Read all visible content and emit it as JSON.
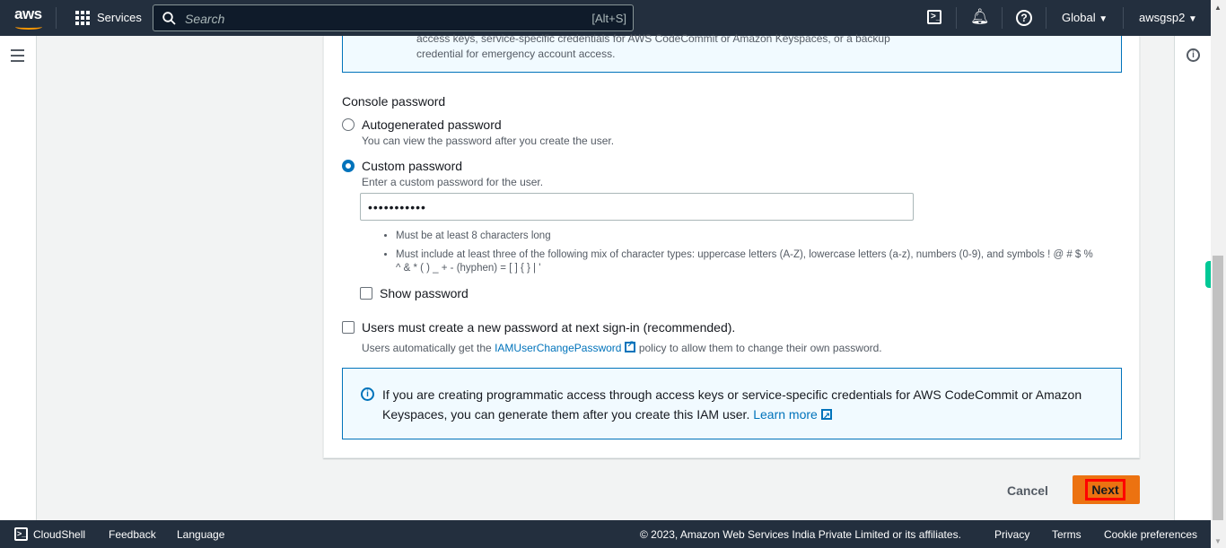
{
  "nav": {
    "logo": "aws",
    "services": "Services",
    "search_placeholder": "Search",
    "search_shortcut": "[Alt+S]",
    "region": "Global",
    "account": "awsgsp2"
  },
  "top_info": {
    "line1": "access keys, service-specific credentials for AWS CodeCommit or Amazon Keyspaces, or a backup",
    "line2": "credential for emergency account access."
  },
  "console_password": {
    "label": "Console password",
    "autogen": {
      "label": "Autogenerated password",
      "desc": "You can view the password after you create the user.",
      "selected": false
    },
    "custom": {
      "label": "Custom password",
      "desc": "Enter a custom password for the user.",
      "selected": true,
      "value": "•••••••••••"
    },
    "rules": [
      "Must be at least 8 characters long",
      "Must include at least three of the following mix of character types: uppercase letters (A-Z), lowercase letters (a-z), numbers (0-9), and symbols ! @ # $ % ^ & * ( ) _ + - (hyphen) = [ ] { } | '"
    ],
    "show_password": "Show password",
    "must_change": "Users must create a new password at next sign-in (recommended).",
    "policy_pre": "Users automatically get the ",
    "policy_link": "IAMUserChangePassword",
    "policy_post": " policy to allow them to change their own password."
  },
  "bottom_info": {
    "text": "If you are creating programmatic access through access keys or service-specific credentials for AWS CodeCommit or Amazon Keyspaces, you can generate them after you create this IAM user.",
    "link": "Learn more"
  },
  "actions": {
    "cancel": "Cancel",
    "next": "Next"
  },
  "footer": {
    "cloudshell": "CloudShell",
    "feedback": "Feedback",
    "language": "Language",
    "copyright": "© 2023, Amazon Web Services India Private Limited or its affiliates.",
    "privacy": "Privacy",
    "terms": "Terms",
    "cookies": "Cookie preferences"
  },
  "colors": {
    "nav": "#232f3e",
    "primary": "#ec7211",
    "link": "#0073bb",
    "highlight": "#ff0000"
  }
}
